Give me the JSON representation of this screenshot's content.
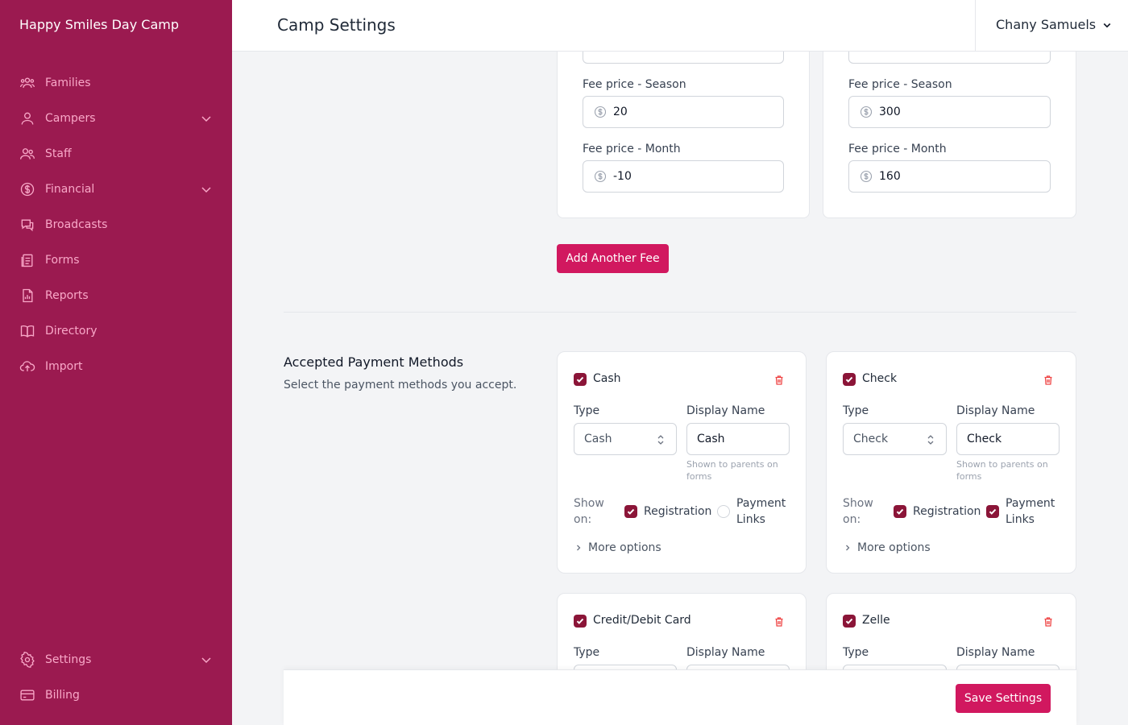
{
  "app": {
    "brand": "Happy Smiles Day Camp"
  },
  "header": {
    "title": "Camp Settings",
    "user_name": "Chany Samuels"
  },
  "sidebar": {
    "items": [
      {
        "label": "Families",
        "icon": "families-icon"
      },
      {
        "label": "Campers",
        "icon": "camper-icon",
        "expandable": true
      },
      {
        "label": "Staff",
        "icon": "staff-icon"
      },
      {
        "label": "Financial",
        "icon": "dollar-icon",
        "expandable": true
      },
      {
        "label": "Broadcasts",
        "icon": "chat-icon"
      },
      {
        "label": "Forms",
        "icon": "forms-icon"
      },
      {
        "label": "Reports",
        "icon": "report-icon"
      },
      {
        "label": "Directory",
        "icon": "book-icon"
      },
      {
        "label": "Import",
        "icon": "upload-cloud-icon"
      }
    ],
    "bottom_items": [
      {
        "label": "Settings",
        "icon": "gear-icon",
        "expandable": true
      },
      {
        "label": "Billing",
        "icon": "credit-card-icon"
      }
    ]
  },
  "fees": [
    {
      "season_label": "Fee price - Season",
      "season_value": "20",
      "month_label": "Fee price - Month",
      "month_value": "-10"
    },
    {
      "season_label": "Fee price - Season",
      "season_value": "300",
      "month_label": "Fee price - Month",
      "month_value": "160"
    }
  ],
  "add_fee_label": "Add Another Fee",
  "payment_section": {
    "title": "Accepted Payment Methods",
    "description": "Select the payment methods you accept.",
    "type_label": "Type",
    "display_name_label": "Display Name",
    "hint": "Shown to parents on forms",
    "show_on_label": "Show on:",
    "registration_label": "Registration",
    "payment_links_label": "Payment Links",
    "more_options_label": "More options",
    "methods": [
      {
        "name": "Cash",
        "enabled": true,
        "type": "Cash",
        "display_name": "Cash",
        "registration": true,
        "payment_links": false
      },
      {
        "name": "Check",
        "enabled": true,
        "type": "Check",
        "display_name": "Check",
        "registration": true,
        "payment_links": true
      },
      {
        "name": "Credit/Debit Card",
        "enabled": true
      },
      {
        "name": "Zelle",
        "enabled": true
      }
    ]
  },
  "save_label": "Save Settings",
  "colors": {
    "sidebar": "#9b1a50",
    "accent": "#d1185f",
    "checkbox": "#8b1538"
  }
}
